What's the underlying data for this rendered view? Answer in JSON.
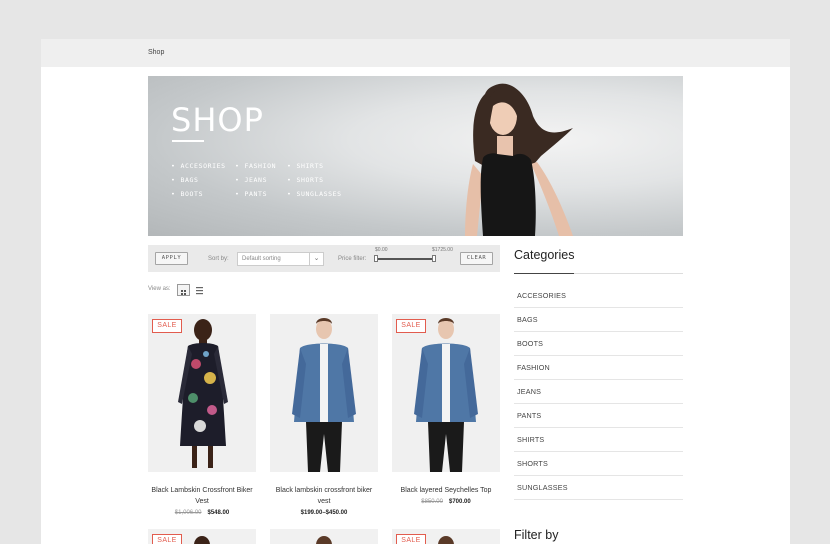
{
  "breadcrumb": "Shop",
  "hero": {
    "title": "SHOP",
    "links": [
      "ACCESORIES",
      "FASHION",
      "SHIRTS",
      "BAGS",
      "JEANS",
      "SHORTS",
      "BOOTS",
      "PANTS",
      "SUNGLASSES"
    ]
  },
  "toolbar": {
    "apply_label": "APPLY",
    "sort_label": "Sort by:",
    "sort_value": "Default sorting",
    "price_filter_label": "Price filter:",
    "price_min": "$0.00",
    "price_max": "$1725.00",
    "clear_label": "CLEAR"
  },
  "view": {
    "label": "View as:"
  },
  "products": [
    {
      "name": "Black Lambskin Crossfront Biker Vest",
      "old_price": "$1,006.00",
      "price": "$548.00",
      "sale": "SALE"
    },
    {
      "name": "Black lambskin crossfront biker vest",
      "old_price": "",
      "price": "$199.00–$450.00",
      "sale": ""
    },
    {
      "name": "Black layered Seychelles Top",
      "old_price": "$850.00",
      "price": "$700.00",
      "sale": "SALE"
    }
  ],
  "second_row_badges": [
    "SALE",
    "SALE"
  ],
  "sidebar": {
    "categories_title": "Categories",
    "categories": [
      "ACCESORIES",
      "BAGS",
      "BOOTS",
      "FASHION",
      "JEANS",
      "PANTS",
      "SHIRTS",
      "SHORTS",
      "SUNGLASSES"
    ],
    "filter_title": "Filter by"
  },
  "colors": {
    "sale": "#e25c4e",
    "page_bg": "#e6e6e6",
    "toolbar_bg": "#eaeaea"
  }
}
